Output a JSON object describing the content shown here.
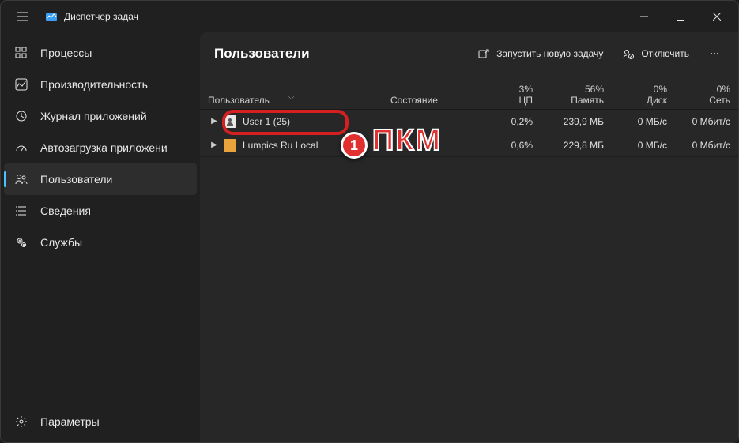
{
  "title": "Диспетчер задач",
  "sidebar": {
    "items": [
      {
        "label": "Процессы"
      },
      {
        "label": "Производительность"
      },
      {
        "label": "Журнал приложений"
      },
      {
        "label": "Автозагрузка приложени"
      },
      {
        "label": "Пользователи"
      },
      {
        "label": "Сведения"
      },
      {
        "label": "Службы"
      }
    ],
    "settings": "Параметры"
  },
  "toolbar": {
    "title": "Пользователи",
    "run_task": "Запустить новую задачу",
    "disconnect": "Отключить"
  },
  "columns": {
    "user": "Пользователь",
    "state": "Состояние",
    "cpu_pct": "3%",
    "cpu_lbl": "ЦП",
    "mem_pct": "56%",
    "mem_lbl": "Память",
    "disk_pct": "0%",
    "disk_lbl": "Диск",
    "net_pct": "0%",
    "net_lbl": "Сеть"
  },
  "rows": [
    {
      "name": "User 1 (25)",
      "state": "",
      "cpu": "0,2%",
      "mem": "239,9 МБ",
      "disk": "0 МБ/с",
      "net": "0 Мбит/с"
    },
    {
      "name": "Lumpics Ru Local",
      "state": "",
      "cpu": "0,6%",
      "mem": "229,8 МБ",
      "disk": "0 МБ/с",
      "net": "0 Мбит/с"
    }
  ],
  "annotation": {
    "badge": "1",
    "text": "ПКМ"
  }
}
